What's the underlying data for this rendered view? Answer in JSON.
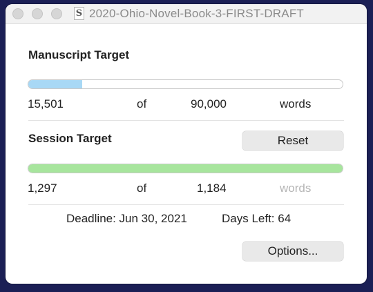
{
  "window": {
    "title": "2020-Ohio-Novel-Book-3-FIRST-DRAFT",
    "doc_icon_glyph": "S"
  },
  "manuscript": {
    "heading": "Manuscript Target",
    "current": "15,501",
    "of": "of",
    "target": "90,000",
    "unit": "words",
    "progress_fraction": 0.172,
    "bar_color": "#a8d8f5"
  },
  "session": {
    "heading": "Session Target",
    "reset_label": "Reset",
    "current": "1,297",
    "of": "of",
    "target": "1,184",
    "unit": "words",
    "progress_fraction": 1.0,
    "bar_color": "#a7e59d"
  },
  "deadline": {
    "label": "Deadline: Jun 30, 2021",
    "days_left": "Days Left: 64"
  },
  "options_label": "Options..."
}
